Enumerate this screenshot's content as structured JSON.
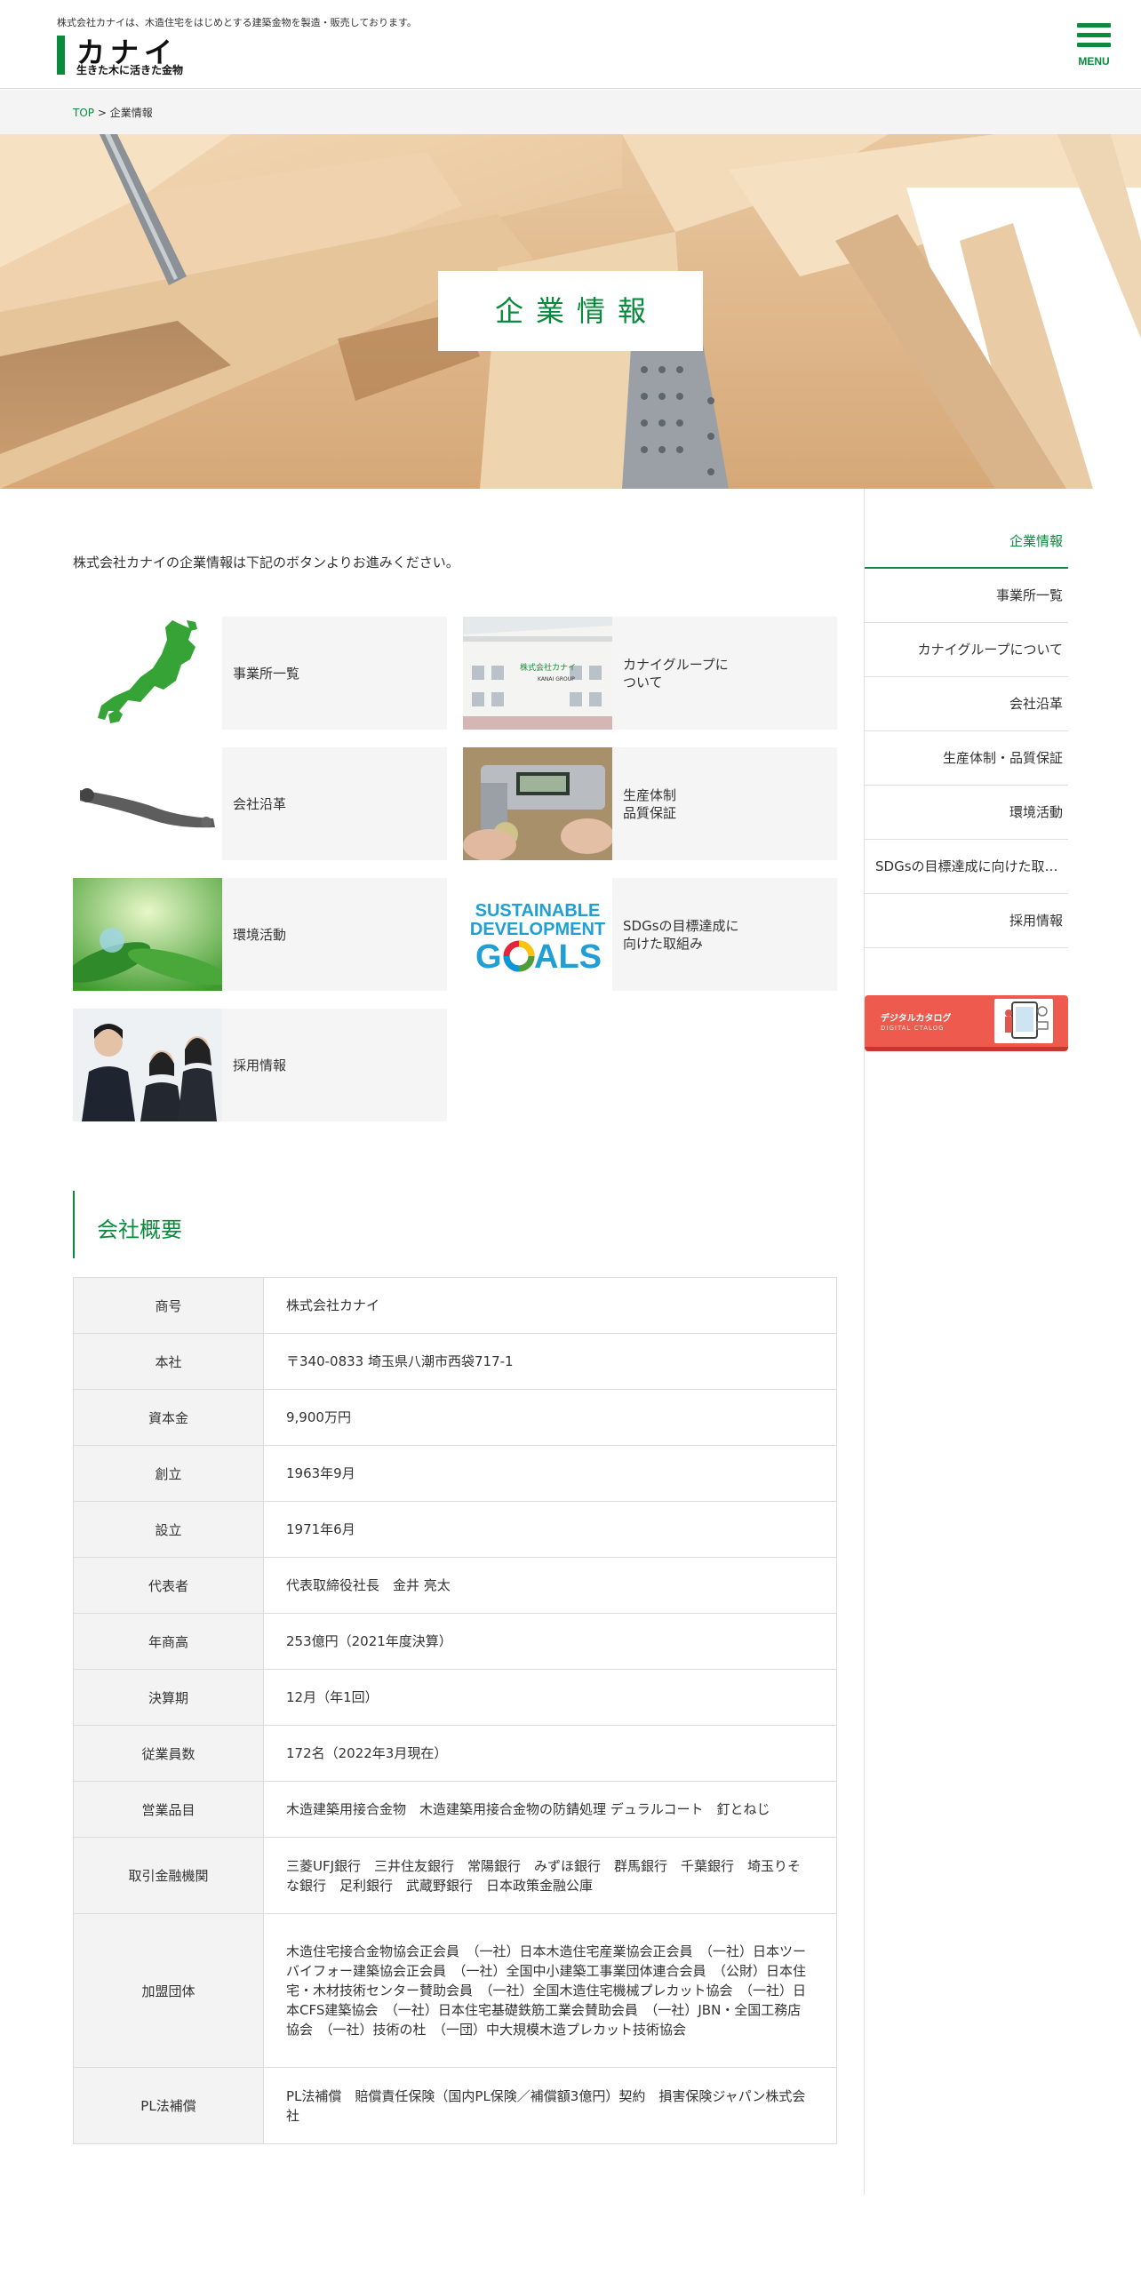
{
  "header": {
    "tagline": "株式会社カナイは、木造住宅をはじめとする建築金物を製造・販売しております。",
    "logo_main": "カナイ",
    "logo_sub": "生きた木に活きた金物",
    "menu_label": "MENU"
  },
  "breadcrumb": {
    "home": "TOP",
    "separator": ">",
    "current": "企業情報"
  },
  "hero": {
    "title": "企業情報"
  },
  "intro": "株式会社カナイの企業情報は下記のボタンよりお進みください。",
  "cards": [
    {
      "label": "事業所一覧",
      "icon": "japan-map-icon"
    },
    {
      "label": "カナイグループに\nついて",
      "icon": "building-photo"
    },
    {
      "label": "会社沿革",
      "icon": "hardware-photo"
    },
    {
      "label": "生産体制\n品質保証",
      "icon": "caliper-photo"
    },
    {
      "label": "環境活動",
      "icon": "leaf-photo"
    },
    {
      "label": "SDGsの目標達成に\n向けた取組み",
      "icon": "sdgs-logo"
    },
    {
      "label": "採用情報",
      "icon": "recruit-photo"
    }
  ],
  "building_sign": "株式会社カナイ",
  "building_sub": "KANAI GROUP",
  "sdgs": {
    "line1": "SUSTAINABLE",
    "line2": "DEVELOPMENT",
    "line3a": "G",
    "line3b": "ALS"
  },
  "overview": {
    "title": "会社概要",
    "rows": [
      {
        "label": "商号",
        "value": "株式会社カナイ"
      },
      {
        "label": "本社",
        "value": "〒340-0833 埼玉県八潮市西袋717-1"
      },
      {
        "label": "資本金",
        "value": "9,900万円"
      },
      {
        "label": "創立",
        "value": "1963年9月"
      },
      {
        "label": "設立",
        "value": "1971年6月"
      },
      {
        "label": "代表者",
        "value": "代表取締役社長　金井 亮太"
      },
      {
        "label": "年商高",
        "value": "253億円（2021年度決算）"
      },
      {
        "label": "決算期",
        "value": "12月（年1回）"
      },
      {
        "label": "従業員数",
        "value": "172名（2022年3月現在）"
      },
      {
        "label": "営業品目",
        "value": "木造建築用接合金物　木造建築用接合金物の防錆処理 デュラルコート　釘とねじ"
      },
      {
        "label": "取引金融機関",
        "value": "三菱UFJ銀行　三井住友銀行　常陽銀行　みずほ銀行　群馬銀行　千葉銀行　埼玉りそな銀行　足利銀行　武蔵野銀行　日本政策金融公庫"
      },
      {
        "label": "加盟団体",
        "value": "木造住宅接合金物協会正会員　（一社）日本木造住宅産業協会正会員　（一社）日本ツーバイフォー建築協会正会員　（一社）全国中小建築工事業団体連合会員　（公財）日本住宅・木材技術センター賛助会員　（一社）全国木造住宅機械プレカット協会　（一社）日本CFS建築協会　（一社）日本住宅基礎鉄筋工業会賛助会員　（一社）JBN・全国工務店協会　（一社）技術の杜　（一団）中大規模木造プレカット技術協会"
      },
      {
        "label": "PL法補償",
        "value": "PL法補償　賠償責任保険（国内PL保険／補償額3億円）契約　損害保険ジャパン株式会社"
      }
    ]
  },
  "sidebar": {
    "items": [
      {
        "label": "企業情報",
        "active": true
      },
      {
        "label": "事業所一覧"
      },
      {
        "label": "カナイグループについて"
      },
      {
        "label": "会社沿革"
      },
      {
        "label": "生産体制・品質保証"
      },
      {
        "label": "環境活動"
      },
      {
        "label": "SDGsの目標達成に向けた取組み",
        "align": "left"
      },
      {
        "label": "採用情報"
      }
    ],
    "catalog_title": "デジタルカタログ",
    "catalog_sub": "DIGITAL CTALOG"
  },
  "colors": {
    "brand_green": "#0a8a3c",
    "catalog_red": "#ef5a4f"
  }
}
